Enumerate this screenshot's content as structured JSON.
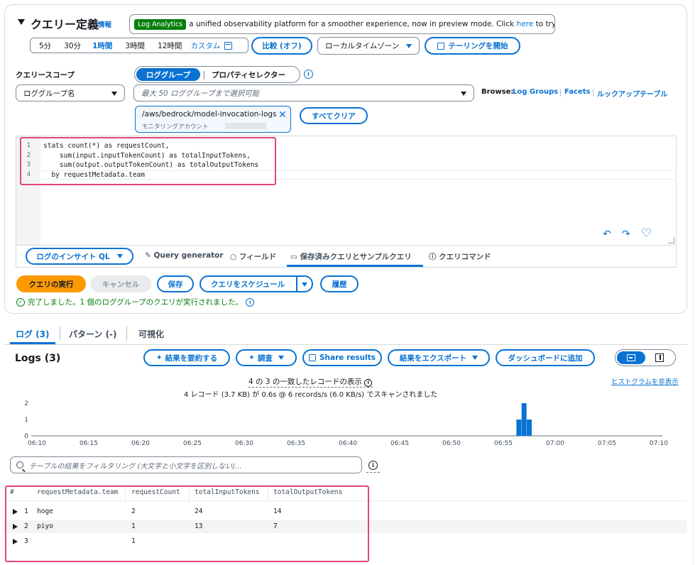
{
  "query": {
    "title": "クエリー定義",
    "info_link": "情報",
    "banner": {
      "badge": "Log Analytics",
      "text_before": "a unified observability platform for a smoother experience, now in preview mode. Click",
      "link": "here",
      "text_after": "to try it out!"
    },
    "time_ranges": [
      "5分",
      "30分",
      "1時間",
      "3時間",
      "12時間",
      "カスタム"
    ],
    "selected_time_range": "1時間",
    "compare_label": "比較 (オフ)",
    "timezone": "ローカルタイムゾーン",
    "tail_label": "テーリングを開始",
    "scope_label": "クエリースコープ",
    "scope_tabs": [
      "ロググループ",
      "プロパティセレクター"
    ],
    "scope_selected": "ロググループ",
    "group_by": "ロググループ名",
    "group_placeholder": "最大 50 ロググループまで選択可能",
    "browse_label": "Browse:",
    "browse_links": [
      "Log Groups",
      "Facets",
      "ルックアップテーブル"
    ],
    "selected_group": {
      "name": "/aws/bedrock/model-invocation-logs",
      "account": "モニタリングアカウント"
    },
    "clear_all": "すべてクリア",
    "code_lines": [
      {
        "num": "1",
        "text": "stats count(*) as requestCount,"
      },
      {
        "num": "2",
        "text": "    sum(input.inputTokenCount) as totalInputTokens,"
      },
      {
        "num": "3",
        "text": "    sum(output.outputTokenCount) as totalOutputTokens"
      },
      {
        "num": "4",
        "text": "  by requestMetadata.team"
      }
    ],
    "lang_select": "ログのインサイト QL",
    "editor_tabs": [
      "Query generator",
      "フィールド",
      "保存済みクエリとサンプルクエリ",
      "クエリコマンド"
    ],
    "active_editor_tab": "保存済みクエリとサンプルクエリ",
    "run_label": "クエリの実行",
    "cancel_label": "キャンセル",
    "save_label": "保存",
    "schedule_label": "クエリをスケジュール",
    "history_label": "履歴",
    "status": "完了しました。1 個のロググループのクエリが実行されました。"
  },
  "results": {
    "tabs": [
      "ログ (3)",
      "パターン (-)",
      "可視化"
    ],
    "active_tab": "ログ (3)",
    "title": "Logs (3)",
    "actions": [
      "結果を要約する",
      "調査",
      "Share results",
      "結果をエクスポート",
      "ダッシュボードに追加"
    ],
    "summary_line1": "4 の 3 の一致したレコードの表示",
    "summary_line2": "4 レコード (3.7 KB) が 0.6s @ 6 records/s (6.0 KB/s) でスキャンされました",
    "hide_histogram": "ヒストグラムを非表示",
    "filter_placeholder": "テーブルの結果をフィルタリング (大文字と小文字を区別しない)...",
    "columns": [
      "#",
      "requestMetadata.team",
      "requestCount",
      "totalInputTokens",
      "totalOutputTokens"
    ],
    "rows": [
      {
        "index": "1",
        "team": "hoge",
        "requestCount": "2",
        "totalInputTokens": "24",
        "totalOutputTokens": "14"
      },
      {
        "index": "2",
        "team": "piyo",
        "requestCount": "1",
        "totalInputTokens": "13",
        "totalOutputTokens": "7"
      },
      {
        "index": "3",
        "team": "",
        "requestCount": "1",
        "totalInputTokens": "",
        "totalOutputTokens": ""
      }
    ]
  },
  "chart_data": {
    "type": "bar",
    "x_ticks": [
      "06:10",
      "06:15",
      "06:20",
      "06:25",
      "06:30",
      "06:35",
      "06:40",
      "06:45",
      "06:50",
      "06:55",
      "07:00",
      "07:05",
      "07:10"
    ],
    "y_ticks": [
      "0",
      "1",
      "2"
    ],
    "ylim": [
      0,
      2
    ],
    "bars": [
      {
        "x": "06:56:30",
        "value": 1
      },
      {
        "x": "06:57:00",
        "value": 2
      },
      {
        "x": "06:57:30",
        "value": 1
      }
    ],
    "color": "#0972d3"
  },
  "colors": {
    "accent": "#0972d3",
    "run": "#ff9900",
    "highlight": "#e0457b",
    "success": "#037f0c"
  }
}
